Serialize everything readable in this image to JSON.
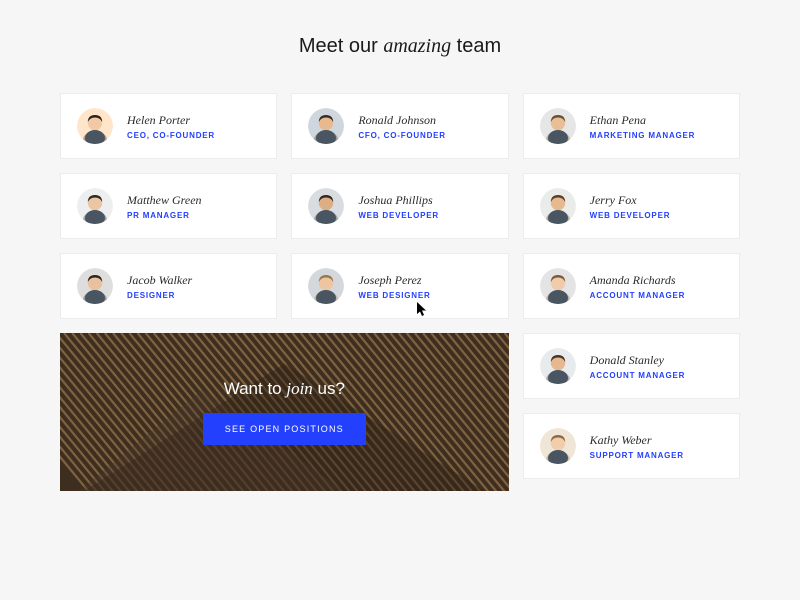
{
  "heading": {
    "pre": "Meet our ",
    "italic": "amazing",
    "post": " team"
  },
  "team": [
    {
      "name": "Helen Porter",
      "role": "CEO, CO-FOUNDER",
      "bg": "#ffe5c9",
      "skin": "#f2c9a4",
      "hair": "#2b2118"
    },
    {
      "name": "Ronald Johnson",
      "role": "CFO, CO-FOUNDER",
      "bg": "#cfd6dd",
      "skin": "#e8b98f",
      "hair": "#3a2d20"
    },
    {
      "name": "Ethan Pena",
      "role": "MARKETING MANAGER",
      "bg": "#e6e6e6",
      "skin": "#e9bd96",
      "hair": "#6b4e2e"
    },
    {
      "name": "Matthew Green",
      "role": "PR MANAGER",
      "bg": "#eceef0",
      "skin": "#ecc6a2",
      "hair": "#2f261c"
    },
    {
      "name": "Joshua Phillips",
      "role": "WEB DEVELOPER",
      "bg": "#d9dde1",
      "skin": "#dcae85",
      "hair": "#33281c"
    },
    {
      "name": "Jerry Fox",
      "role": "WEB DEVELOPER",
      "bg": "#e9ece9",
      "skin": "#e7b98e",
      "hair": "#5a3f25"
    },
    {
      "name": "Jacob Walker",
      "role": "DESIGNER",
      "bg": "#dedede",
      "skin": "#eac19e",
      "hair": "#2e2419"
    },
    {
      "name": "Joseph Perez",
      "role": "WEB DESIGNER",
      "bg": "#d4d8dc",
      "skin": "#edc6a1",
      "hair": "#9b7848"
    },
    {
      "name": "Amanda Richards",
      "role": "ACCOUNT MANAGER",
      "bg": "#e4e4e4",
      "skin": "#f0cbaa",
      "hair": "#7a5a38"
    },
    {
      "name": "Donald Stanley",
      "role": "ACCOUNT MANAGER",
      "bg": "#e8ebee",
      "skin": "#e5b88f",
      "hair": "#4a3622"
    },
    {
      "name": "Kathy Weber",
      "role": "SUPPORT MANAGER",
      "bg": "#efe6d8",
      "skin": "#f2cda9",
      "hair": "#8f6a3e"
    }
  ],
  "cta": {
    "title_pre": "Want to ",
    "title_italic": "join",
    "title_post": " us?",
    "button": "SEE OPEN POSITIONS"
  }
}
